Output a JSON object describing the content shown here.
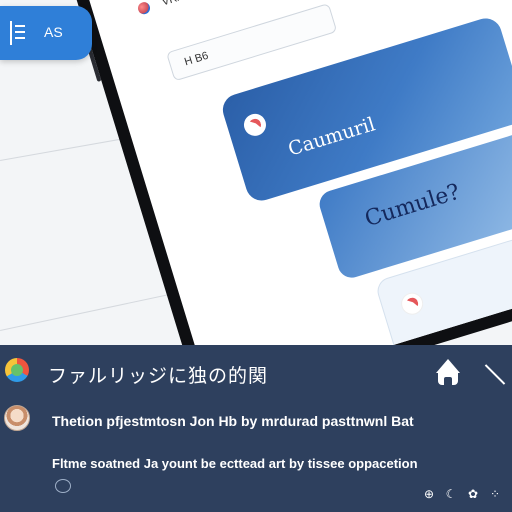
{
  "badge": {
    "label": "AS",
    "icon": "list-icon"
  },
  "phone": {
    "top_url": "",
    "profile_label": "VRAD",
    "search_text": "H B6",
    "card_primary": {
      "kicker": "",
      "stats": "",
      "title": "Caumuril"
    },
    "card_question": {
      "title": "Cumule?"
    },
    "card_secondary": {
      "body": "",
      "link": ""
    },
    "send_label": "➤"
  },
  "panel": {
    "title": "ファルリッジに独の的関",
    "messages": [
      "Thetion pfjestmtosn Jon Hb by mrdurad pasttnwnl Bat",
      "Fltme soatned Ja yount be ecttead art by tissee oppacetion"
    ],
    "icons": [
      "home-icon",
      "close-icon",
      "chat-bubble-icon",
      "zoom-icon",
      "moon-icon",
      "settings-icon",
      "share-icon"
    ],
    "colors": {
      "panel_bg": "#2e405e",
      "accent": "#2f7fd8"
    }
  }
}
